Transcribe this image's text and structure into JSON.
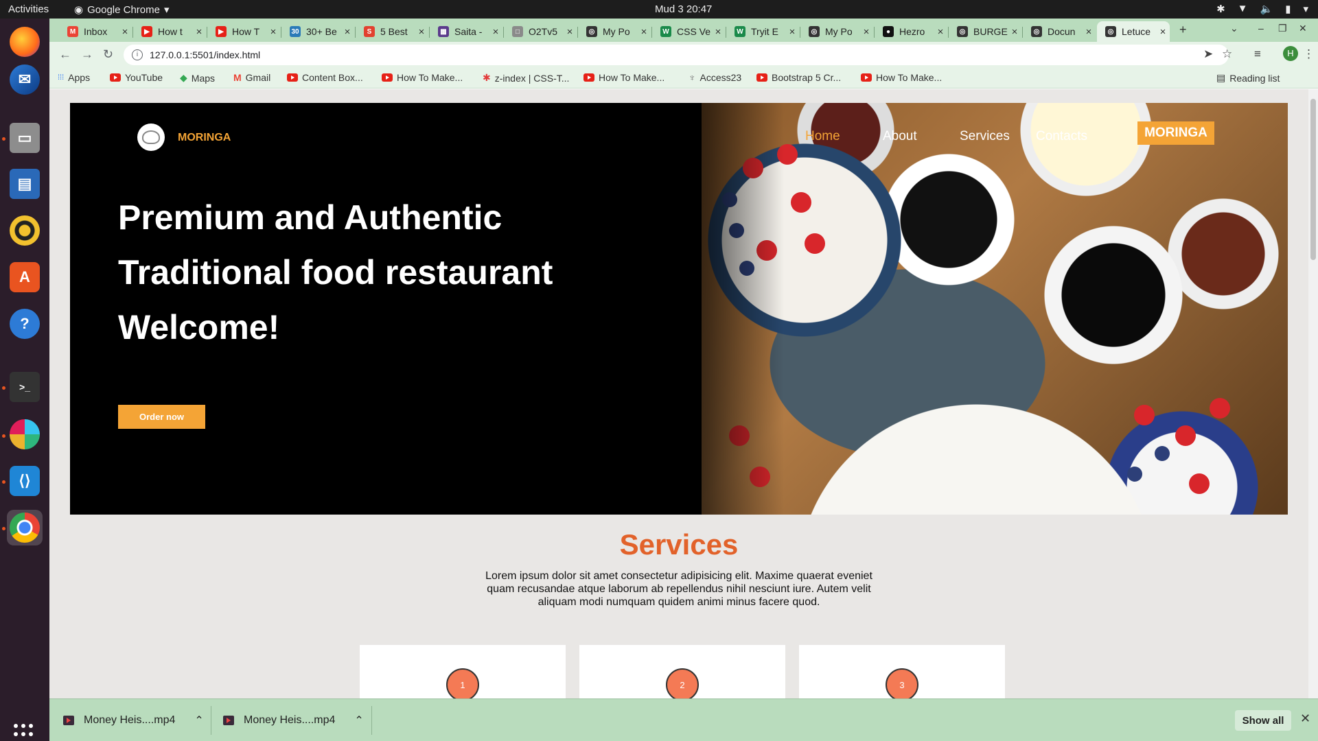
{
  "os": {
    "activities": "Activities",
    "app_menu": "Google Chrome",
    "clock": "Mud 3  20:47"
  },
  "tabs": [
    {
      "label": "Inbox",
      "fav_color": "#ea4335",
      "fav_glyph": "M"
    },
    {
      "label": "How t",
      "fav_color": "#e62117",
      "fav_glyph": "▶"
    },
    {
      "label": "How T",
      "fav_color": "#e62117",
      "fav_glyph": "▶"
    },
    {
      "label": "30+ Be",
      "fav_color": "#2a7ab8",
      "fav_glyph": "30"
    },
    {
      "label": "5 Best",
      "fav_color": "#e2412f",
      "fav_glyph": "S"
    },
    {
      "label": "Saita -",
      "fav_color": "#5b3a8c",
      "fav_glyph": "▦"
    },
    {
      "label": "O2Tv5",
      "fav_color": "#8a8a8a",
      "fav_glyph": "□"
    },
    {
      "label": "My Po",
      "fav_color": "#333333",
      "fav_glyph": "◎"
    },
    {
      "label": "CSS Ve",
      "fav_color": "#1a8a4a",
      "fav_glyph": "W"
    },
    {
      "label": "Tryit E",
      "fav_color": "#1a8a4a",
      "fav_glyph": "W"
    },
    {
      "label": "My Po",
      "fav_color": "#333333",
      "fav_glyph": "◎"
    },
    {
      "label": "Hezro",
      "fav_color": "#111111",
      "fav_glyph": "●"
    },
    {
      "label": "BURGE",
      "fav_color": "#333333",
      "fav_glyph": "◎"
    },
    {
      "label": "Docun",
      "fav_color": "#333333",
      "fav_glyph": "◎"
    },
    {
      "label": "Letuce",
      "fav_color": "#333333",
      "fav_glyph": "◎",
      "active": true
    }
  ],
  "address": {
    "url": "127.0.0.1:5501/index.html",
    "avatar_letter": "H"
  },
  "bookmarks": [
    "Apps",
    "YouTube",
    "Maps",
    "Gmail",
    "Content Box...",
    "How To Make...",
    "z-index | CSS-T...",
    "How To Make...",
    "Access23",
    "Bootstrap 5 Cr...",
    "How To Make..."
  ],
  "reading_list": "Reading list",
  "site": {
    "logo_text": "MORINGA",
    "nav": [
      "Home",
      "About",
      "Services",
      "Contacts"
    ],
    "nav_cta": "MORINGA",
    "hero_lines": [
      "Premium and Authentic",
      "Traditional food restaurant",
      "Welcome!"
    ],
    "order_button": "Order now",
    "services_title": "Services",
    "services_text": "Lorem ipsum dolor sit amet consectetur adipisicing elit. Maxime quaerat eveniet quam recusandae atque laborum ab repellendus nihil nesciunt iure. Autem velit aliquam modi numquam quidem animi minus facere quod.",
    "cards": [
      "1",
      "2",
      "3"
    ],
    "accent": "#f4a436",
    "title_color": "#e2622a"
  },
  "downloads": {
    "items": [
      "Money Heis....mp4",
      "Money Heis....mp4"
    ],
    "show_all": "Show all"
  }
}
